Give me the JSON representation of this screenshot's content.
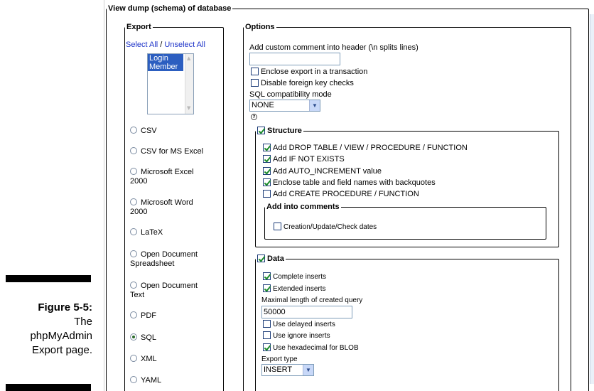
{
  "caption": {
    "figure": "Figure 5-5:",
    "line1": "The",
    "line2": "phpMyAdmin",
    "line3": "Export page."
  },
  "main_legend": "View dump (schema) of database",
  "export": {
    "legend": "Export",
    "select_all": "Select All",
    "separator": " / ",
    "unselect_all": "Unselect All",
    "tables": [
      "Login",
      "Member"
    ],
    "formats": [
      {
        "line1": "CSV",
        "line2": "",
        "selected": false
      },
      {
        "line1": "CSV for MS Excel",
        "line2": "",
        "selected": false
      },
      {
        "line1": "Microsoft Excel",
        "line2": "2000",
        "selected": false
      },
      {
        "line1": "Microsoft Word",
        "line2": "2000",
        "selected": false
      },
      {
        "line1": "LaTeX",
        "line2": "",
        "selected": false
      },
      {
        "line1": "Open Document",
        "line2": "Spreadsheet",
        "selected": false
      },
      {
        "line1": "Open Document",
        "line2": "Text",
        "selected": false
      },
      {
        "line1": "PDF",
        "line2": "",
        "selected": false
      },
      {
        "line1": "SQL",
        "line2": "",
        "selected": true
      },
      {
        "line1": "XML",
        "line2": "",
        "selected": false
      },
      {
        "line1": "YAML",
        "line2": "",
        "selected": false
      }
    ]
  },
  "options": {
    "legend": "Options",
    "comment_label": "Add custom comment into header (\\n splits lines)",
    "comment_value": "",
    "transaction": {
      "label": "Enclose export in a transaction",
      "checked": false
    },
    "foreign_keys": {
      "label": "Disable foreign key checks",
      "checked": false
    },
    "compat_label": "SQL compatibility mode",
    "compat_value": "NONE",
    "structure": {
      "legend": "Structure",
      "checked": true,
      "items": [
        {
          "label": "Add DROP TABLE / VIEW / PROCEDURE / FUNCTION",
          "checked": true
        },
        {
          "label": "Add IF NOT EXISTS",
          "checked": true
        },
        {
          "label": "Add AUTO_INCREMENT value",
          "checked": true
        },
        {
          "label": "Enclose table and field names with backquotes",
          "checked": true
        },
        {
          "label": "Add CREATE PROCEDURE / FUNCTION",
          "checked": false
        }
      ],
      "comments": {
        "legend": "Add into comments",
        "dates": {
          "label": "Creation/Update/Check dates",
          "checked": false
        }
      }
    },
    "data": {
      "legend": "Data",
      "checked": true,
      "complete_inserts": {
        "label": "Complete inserts",
        "checked": true
      },
      "extended_inserts": {
        "label": "Extended inserts",
        "checked": true
      },
      "max_length_label": "Maximal length of created query",
      "max_length_value": "50000",
      "delayed": {
        "label": "Use delayed inserts",
        "checked": false
      },
      "ignore": {
        "label": "Use ignore inserts",
        "checked": false
      },
      "hex_blob": {
        "label": "Use hexadecimal for BLOB",
        "checked": true
      },
      "export_type_label": "Export type",
      "export_type_value": "INSERT"
    }
  }
}
